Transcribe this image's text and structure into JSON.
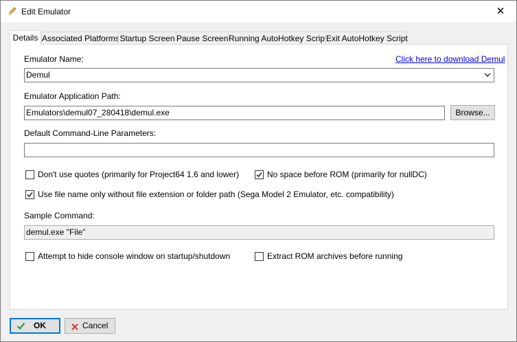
{
  "window": {
    "title": "Edit Emulator",
    "close_glyph": "✕"
  },
  "tabs": [
    {
      "label": "Details",
      "active": true
    },
    {
      "label": "Associated Platforms"
    },
    {
      "label": "Startup Screen"
    },
    {
      "label": "Pause Screen"
    },
    {
      "label": "Running AutoHotkey Script"
    },
    {
      "label": "Exit AutoHotkey Script"
    }
  ],
  "details": {
    "emulator_name_label": "Emulator Name:",
    "download_link": "Click here to download Demul",
    "emulator_name_value": "Demul",
    "app_path_label": "Emulator Application Path:",
    "app_path_value": "Emulators\\demul07_280418\\demul.exe",
    "browse_label": "Browse...",
    "cmdline_label": "Default Command-Line Parameters:",
    "cmdline_value": "",
    "cb_no_quotes": {
      "label": "Don't use quotes (primarily for Project64 1.6 and lower)",
      "checked": false
    },
    "cb_no_space": {
      "label": "No space before ROM (primarily for nullDC)",
      "checked": true
    },
    "cb_filename_only": {
      "label": "Use file name only without file extension or folder path (Sega Model 2 Emulator, etc. compatibility)",
      "checked": true
    },
    "sample_label": "Sample Command:",
    "sample_value": "demul.exe \"File\"",
    "cb_hide_console": {
      "label": "Attempt to hide console window on startup/shutdown",
      "checked": false
    },
    "cb_extract_rom": {
      "label": "Extract ROM archives before running",
      "checked": false
    }
  },
  "footer": {
    "ok_label": "OK",
    "cancel_label": "Cancel"
  },
  "colors": {
    "ok_check": "#2e9e2e",
    "cancel_x": "#d13438",
    "link": "#0000ee",
    "default_border": "#0078d7"
  }
}
